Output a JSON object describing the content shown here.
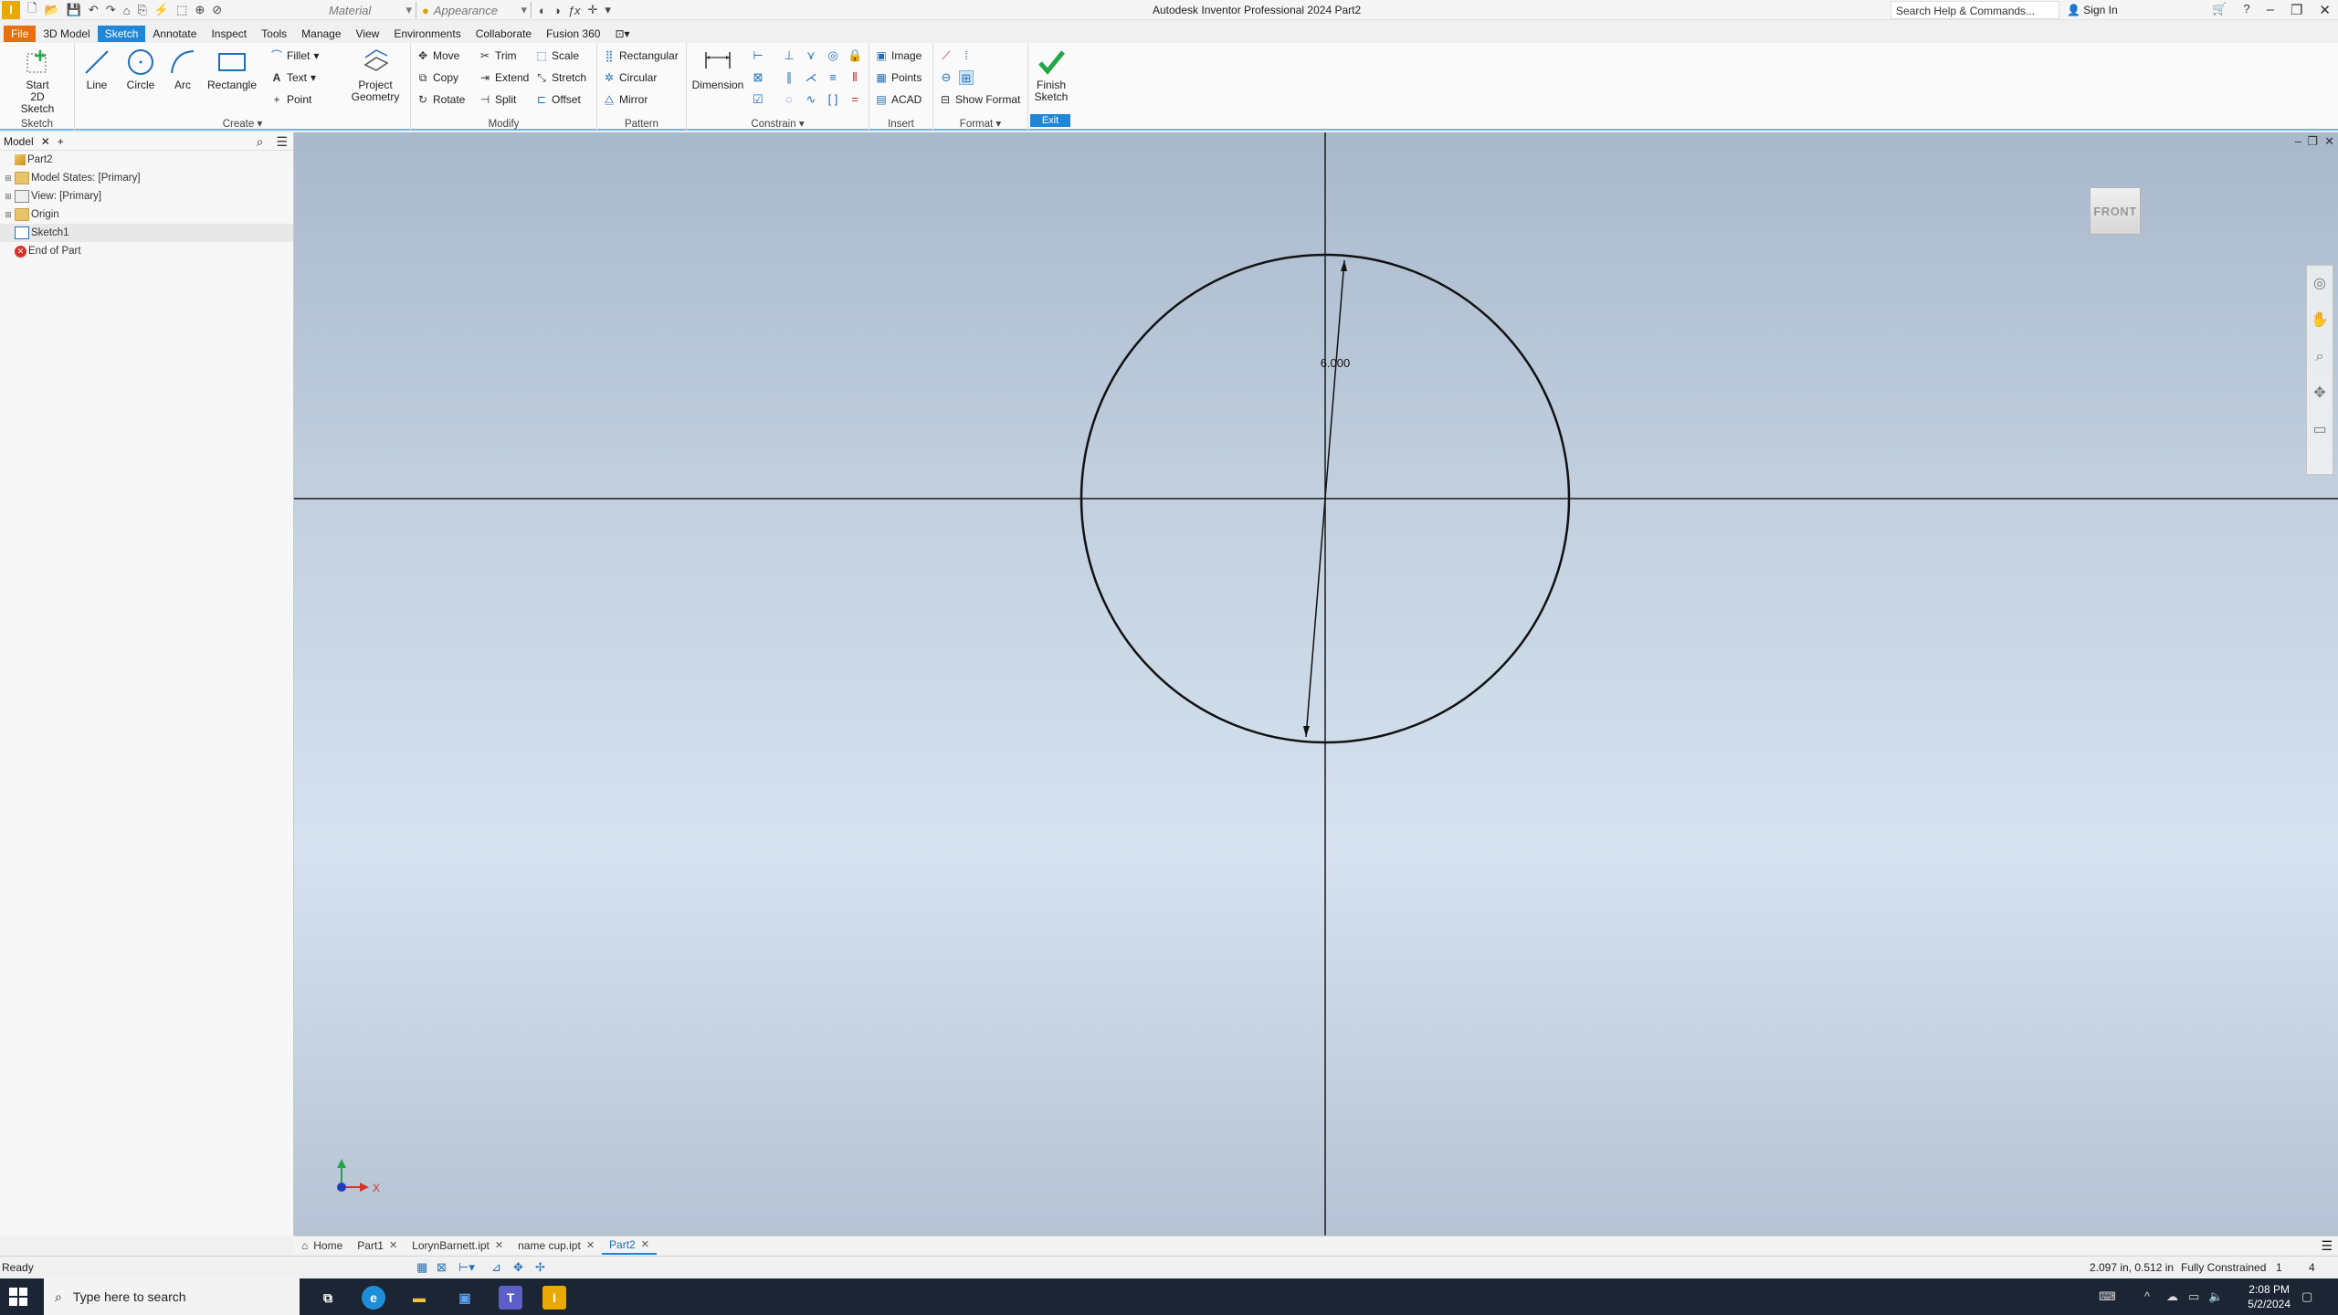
{
  "app": {
    "title": "Autodesk Inventor Professional 2024   Part2",
    "logo": "I",
    "material_placeholder": "Material",
    "appearance_placeholder": "Appearance",
    "help_search": "Search Help & Commands...",
    "sign_in": "Sign In"
  },
  "menu_tabs": [
    "File",
    "3D Model",
    "Sketch",
    "Annotate",
    "Inspect",
    "Tools",
    "Manage",
    "View",
    "Environments",
    "Collaborate",
    "Fusion 360"
  ],
  "ribbon": {
    "sketch_group": {
      "label": "Sketch",
      "start_2d_line1": "Start",
      "start_2d_line2": "2D Sketch"
    },
    "create_group": {
      "label": "Create",
      "line": "Line",
      "circle": "Circle",
      "arc": "Arc",
      "rectangle": "Rectangle",
      "fillet": "Fillet",
      "text": "Text",
      "point": "Point",
      "project_line1": "Project",
      "project_line2": "Geometry"
    },
    "modify_group": {
      "label": "Modify",
      "move": "Move",
      "trim": "Trim",
      "scale": "Scale",
      "copy": "Copy",
      "extend": "Extend",
      "stretch": "Stretch",
      "rotate": "Rotate",
      "split": "Split",
      "offset": "Offset"
    },
    "pattern_group": {
      "label": "Pattern",
      "rectangular": "Rectangular",
      "circular": "Circular",
      "mirror": "Mirror"
    },
    "constrain_group": {
      "label": "Constrain",
      "dimension": "Dimension"
    },
    "insert_group": {
      "label": "Insert",
      "image": "Image",
      "points": "Points",
      "acad": "ACAD"
    },
    "format_group": {
      "label": "Format",
      "show_format": "Show Format"
    },
    "exit_group": {
      "label": "Exit",
      "finish_line1": "Finish",
      "finish_line2": "Sketch"
    }
  },
  "browser": {
    "tab_label": "Model",
    "tree": [
      {
        "label": "Part2",
        "icon": "part-icon"
      },
      {
        "label": "Model States: [Primary]",
        "icon": "folder-icon"
      },
      {
        "label": "View: [Primary]",
        "icon": "view-icon"
      },
      {
        "label": "Origin",
        "icon": "folder-icon"
      },
      {
        "label": "Sketch1",
        "icon": "sketch-icon"
      },
      {
        "label": "End of Part",
        "icon": "end-of-part-icon"
      }
    ]
  },
  "canvas": {
    "viewcube_label": "FRONT",
    "dimension_value": "6.000",
    "axis_x": "X"
  },
  "doc_tabs": [
    "Home",
    "Part1",
    "LorynBarnett.ipt",
    "name cup.ipt",
    "Part2"
  ],
  "status": {
    "left": "Ready",
    "coords": "2.097 in, 0.512 in",
    "constraint": "Fully Constrained",
    "count1": "1",
    "count2": "4"
  },
  "taskbar": {
    "search_placeholder": "Type here to search",
    "time": "2:08 PM",
    "date": "5/2/2024"
  },
  "colors": {
    "accent": "#1f86d8",
    "file_tab": "#e8700c",
    "finish_check": "#22a745"
  }
}
